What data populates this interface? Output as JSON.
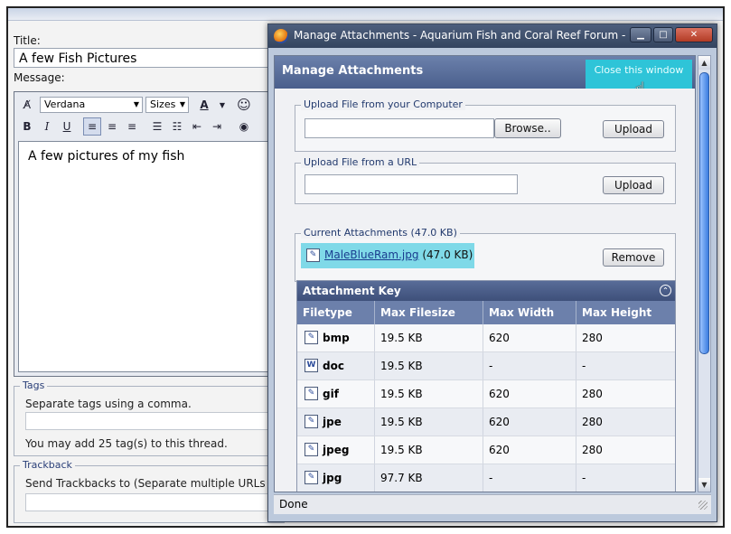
{
  "form": {
    "title_label": "Title:",
    "title_value": "A few Fish Pictures",
    "message_label": "Message:",
    "font_select": "Verdana",
    "size_select": "Sizes",
    "message_text": "A few pictures of my fish",
    "tags_legend": "Tags",
    "tags_hint": "Separate tags using a comma.",
    "tags_limit": "You may add 25 tag(s) to this thread.",
    "trackback_legend": "Trackback",
    "trackback_hint": "Send Trackbacks to (Separate multiple URLs w"
  },
  "popup": {
    "window_title": "Manage Attachments - Aquarium Fish and Coral Reef Forum - Moz...",
    "header": "Manage Attachments",
    "close_link": "Close this window",
    "upload_computer_legend": "Upload File from your Computer",
    "browse_label": "Browse..",
    "upload_label": "Upload",
    "upload_url_legend": "Upload File from a URL",
    "current_legend": "Current Attachments (47.0 KB)",
    "attachment_name": "MaleBlueRam.jpg",
    "attachment_size": "(47.0 KB)",
    "remove_label": "Remove",
    "status": "Done"
  },
  "attachment_key": {
    "title": "Attachment Key",
    "columns": [
      "Filetype",
      "Max Filesize",
      "Max Width",
      "Max Height"
    ],
    "rows": [
      [
        "bmp",
        "19.5 KB",
        "620",
        "280"
      ],
      [
        "doc",
        "19.5 KB",
        "-",
        "-"
      ],
      [
        "gif",
        "19.5 KB",
        "620",
        "280"
      ],
      [
        "jpe",
        "19.5 KB",
        "620",
        "280"
      ],
      [
        "jpeg",
        "19.5 KB",
        "620",
        "280"
      ],
      [
        "jpg",
        "97.7 KB",
        "-",
        "-"
      ]
    ]
  },
  "colors": {
    "titlebar": "#3b4b68",
    "header": "#5a6f9c",
    "highlight": "#2ec4d8"
  }
}
